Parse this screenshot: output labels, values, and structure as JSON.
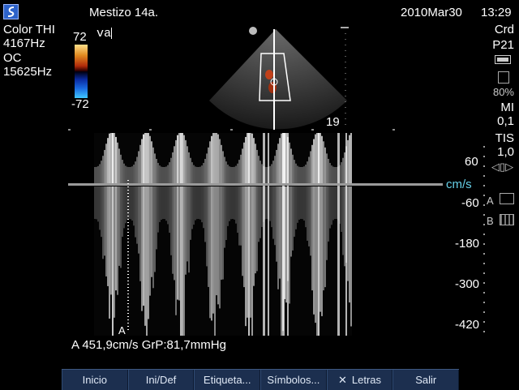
{
  "header": {
    "patient": "Mestizo 14a.",
    "date": "2010Mar30",
    "time": "13:29"
  },
  "left_params": {
    "mode": "Color THI",
    "freq": "4167Hz",
    "oc": "OC",
    "prf": "15625Hz"
  },
  "color_scale": {
    "max": "72",
    "min": "-72"
  },
  "annotation_text": "va",
  "right_params": {
    "app": "Crd",
    "probe": "P21",
    "percent": "80%",
    "mi_label": "MI",
    "mi_value": "0,1",
    "tis_label": "TIS",
    "tis_value": "1,0",
    "a_label": "A",
    "b_label": "B"
  },
  "depth_marker": "19",
  "velocity_scale": {
    "unit": "cm/s",
    "labels": [
      "60",
      "-60",
      "-180",
      "-300",
      "-420"
    ]
  },
  "cursor_label": "A",
  "measurement": "A  451,9cm/s  GrP:81,7mmHg",
  "menu": [
    "Inicio",
    "Ini/Def",
    "Etiqueta...",
    "Símbolos...",
    "Letras",
    "Salir"
  ],
  "colors": {
    "background": "#000000",
    "menu_bg": "#1c2f4f",
    "cyan": "#66d0e8"
  }
}
